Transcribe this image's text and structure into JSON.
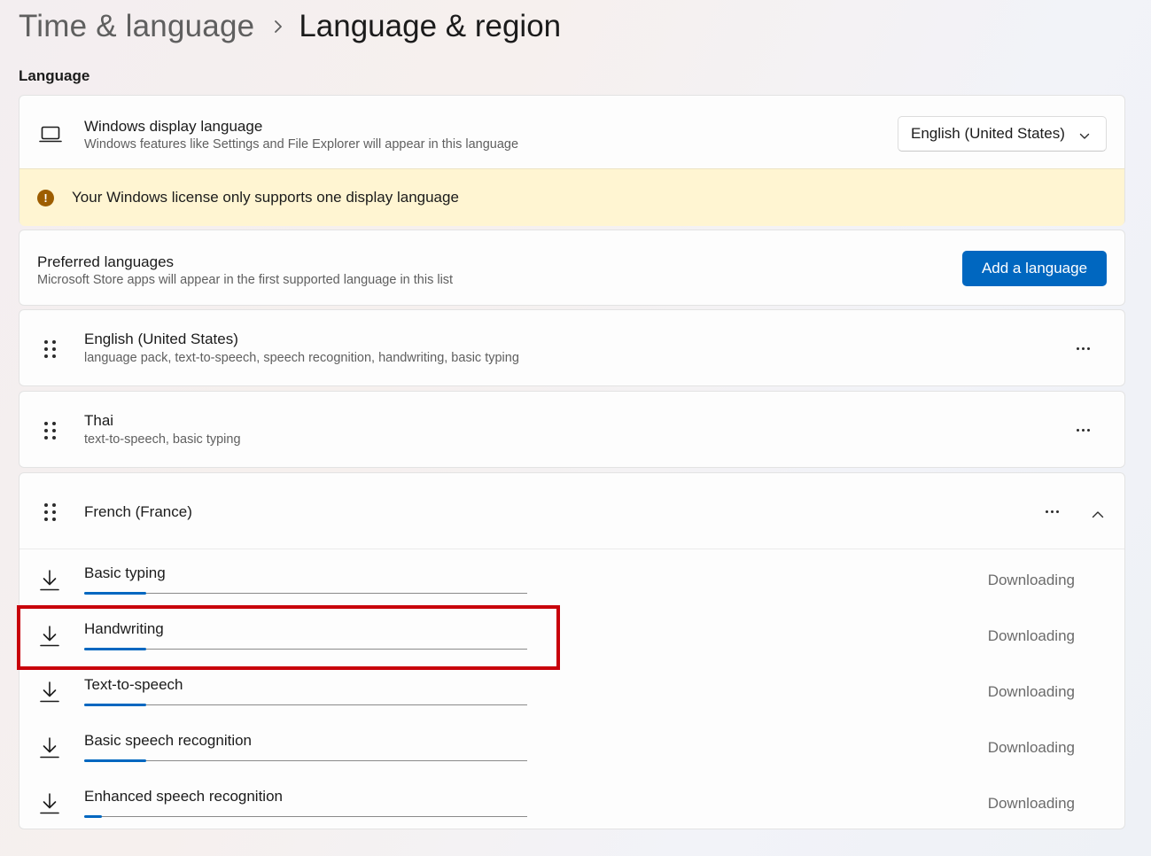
{
  "breadcrumb": {
    "parent": "Time & language",
    "current": "Language & region"
  },
  "section": {
    "title": "Language"
  },
  "display_language": {
    "icon": "laptop-icon",
    "title": "Windows display language",
    "subtitle": "Windows features like Settings and File Explorer will appear in this language",
    "selected": "English (United States)",
    "warning_icon": "warning-icon",
    "warning": "Your Windows license only supports one display language"
  },
  "preferred": {
    "title": "Preferred languages",
    "subtitle": "Microsoft Store apps will appear in the first supported language in this list",
    "add_button": "Add a language"
  },
  "languages": [
    {
      "name": "English (United States)",
      "features": "language pack, text-to-speech, speech recognition, handwriting, basic typing"
    },
    {
      "name": "Thai",
      "features": "text-to-speech, basic typing"
    },
    {
      "name": "French (France)",
      "features": ""
    }
  ],
  "downloads": [
    {
      "name": "Basic typing",
      "status": "Downloading",
      "progress": 0.14
    },
    {
      "name": "Handwriting",
      "status": "Downloading",
      "progress": 0.14
    },
    {
      "name": "Text-to-speech",
      "status": "Downloading",
      "progress": 0.14
    },
    {
      "name": "Basic speech recognition",
      "status": "Downloading",
      "progress": 0.14
    },
    {
      "name": "Enhanced speech recognition",
      "status": "Downloading",
      "progress": 0.01
    }
  ],
  "colors": {
    "accent": "#0067c0",
    "warning_bg": "#fff5d2",
    "warning_icon": "#9d5d00",
    "highlight": "#c8000a"
  }
}
